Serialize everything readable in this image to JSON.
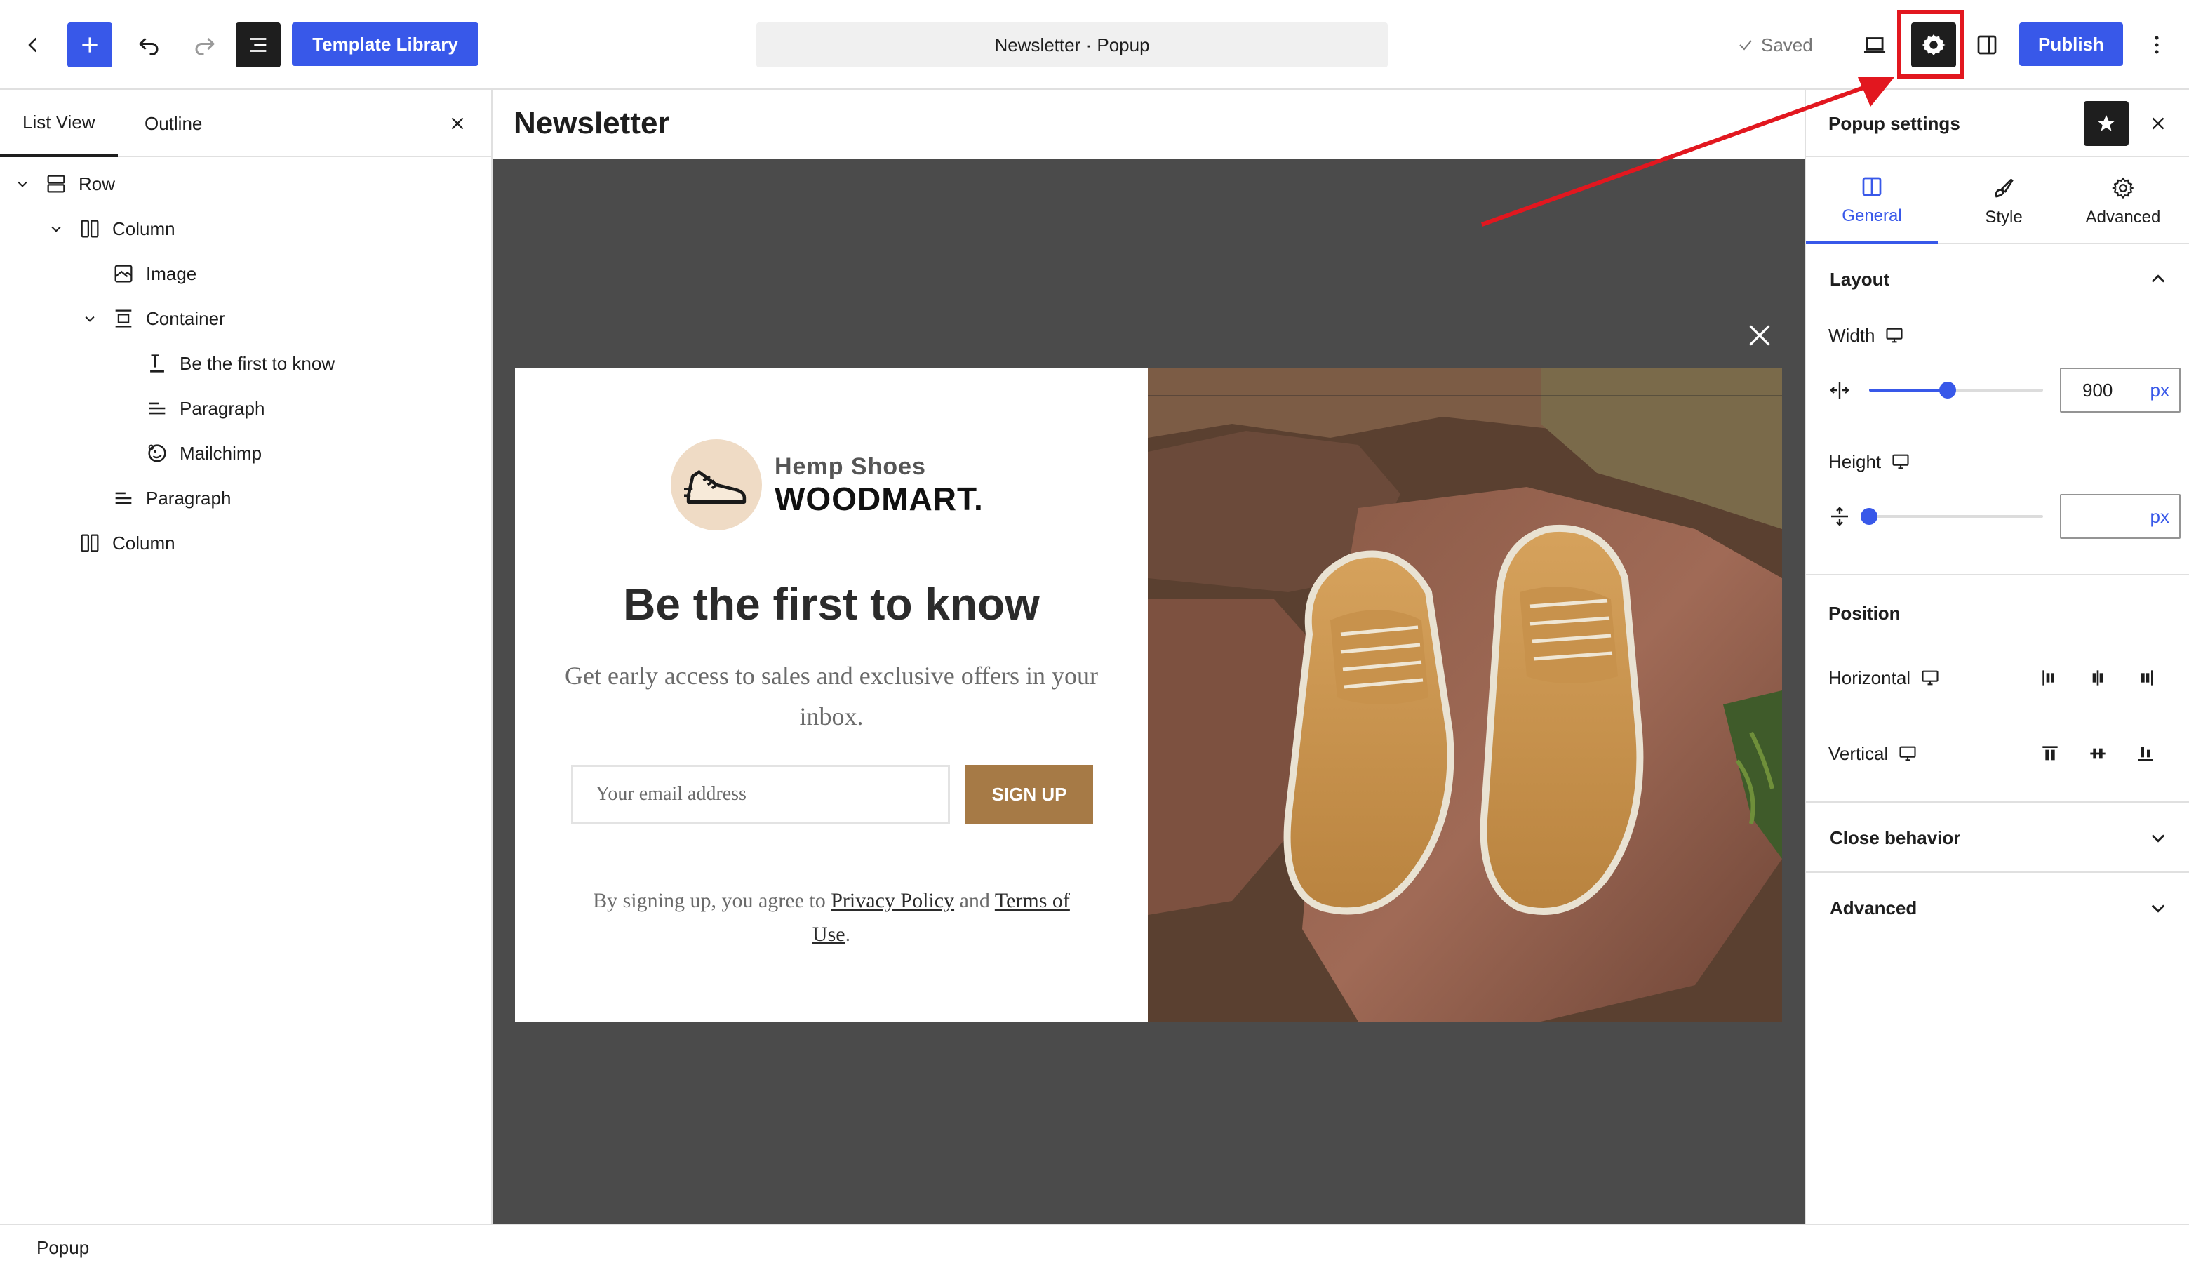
{
  "topbar": {
    "template_library": "Template Library",
    "document_title": "Newsletter · Popup",
    "saved": "Saved",
    "publish": "Publish"
  },
  "left_panel": {
    "tabs": [
      {
        "label": "List View",
        "active": true
      },
      {
        "label": "Outline",
        "active": false
      }
    ],
    "tree": [
      {
        "label": "Row",
        "icon": "row-icon",
        "expanded": true
      },
      {
        "label": "Column",
        "icon": "column-icon",
        "expanded": true
      },
      {
        "label": "Image",
        "icon": "image-icon"
      },
      {
        "label": "Container",
        "icon": "container-icon",
        "expanded": true
      },
      {
        "label": "Be the first to know",
        "icon": "heading-icon"
      },
      {
        "label": "Paragraph",
        "icon": "paragraph-icon"
      },
      {
        "label": "Mailchimp",
        "icon": "mailchimp-icon"
      },
      {
        "label": "Paragraph",
        "icon": "paragraph-icon"
      },
      {
        "label": "Column",
        "icon": "column-icon"
      }
    ]
  },
  "canvas": {
    "title": "Newsletter",
    "popup": {
      "brand_sub": "Hemp Shoes",
      "brand_main": "WOODMART.",
      "heading": "Be the first to know",
      "subtext": "Get early access to sales and exclusive offers in your inbox.",
      "email_placeholder": "Your email address",
      "signup": "SIGN UP",
      "terms_prefix": "By signing up, you agree to ",
      "privacy": "Privacy Policy",
      "terms_and": " and ",
      "terms_link": "Terms of Use",
      "terms_suffix": "."
    }
  },
  "right_panel": {
    "title": "Popup settings",
    "tabs": [
      {
        "label": "General",
        "active": true
      },
      {
        "label": "Style",
        "active": false
      },
      {
        "label": "Advanced",
        "active": false
      }
    ],
    "layout": {
      "heading": "Layout",
      "width_label": "Width",
      "width_value": "900",
      "width_unit": "px",
      "width_slider_fraction": 0.45,
      "height_label": "Height",
      "height_value": "",
      "height_unit": "px",
      "height_slider_fraction": 0.0
    },
    "position": {
      "heading": "Position",
      "horizontal_label": "Horizontal",
      "vertical_label": "Vertical"
    },
    "close_behavior": "Close behavior",
    "advanced": "Advanced"
  },
  "footer": {
    "breadcrumb": "Popup"
  },
  "colors": {
    "accent": "#3858e9",
    "canvas_bg": "#4b4b4b",
    "signup_button": "#a67a46",
    "annotation": "#e2171f"
  }
}
